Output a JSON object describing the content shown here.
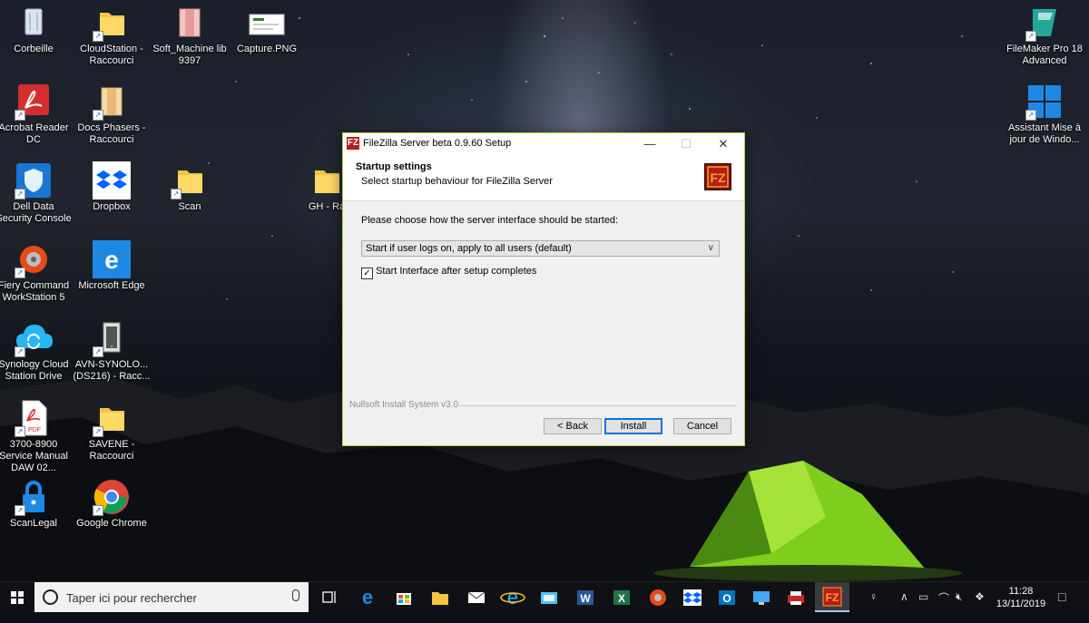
{
  "desktop": {
    "icons": [
      {
        "label": "Corbeille"
      },
      {
        "label": "CloudStation - Raccourci"
      },
      {
        "label": "Soft_Machine lib 9397"
      },
      {
        "label": "Capture.PNG"
      },
      {
        "label": "Acrobat Reader DC"
      },
      {
        "label": "Docs Phasers - Raccourci"
      },
      {
        "label": "Dell Data Security Console"
      },
      {
        "label": "Dropbox"
      },
      {
        "label": "Scan"
      },
      {
        "label": "GH - Ra"
      },
      {
        "label": "Fiery Command WorkStation 5"
      },
      {
        "label": "Microsoft Edge"
      },
      {
        "label": "Synology Cloud Station Drive"
      },
      {
        "label": "AVN-SYNOLO... (DS216) - Racc..."
      },
      {
        "label": "3700-8900 Service Manual DAW 02..."
      },
      {
        "label": "SAVENE - Raccourci"
      },
      {
        "label": "ScanLegal"
      },
      {
        "label": "Google Chrome"
      },
      {
        "label": "FileMaker Pro 18 Advanced"
      },
      {
        "label": "Assistant Mise à jour de Windo..."
      }
    ]
  },
  "dialog": {
    "title": "FileZilla Server beta 0.9.60 Setup",
    "app_icon": "FZ",
    "header_title": "Startup settings",
    "header_subtitle": "Select startup behaviour for FileZilla Server",
    "prompt": "Please choose how the server interface should be started:",
    "startup_option": "Start if user logs on, apply to all users (default)",
    "checkbox_label": "Start Interface after setup completes",
    "checkbox_checked": true,
    "footer_brand": "Nullsoft Install System v3.0",
    "back_label": "< Back",
    "install_label": "Install",
    "cancel_label": "Cancel",
    "minimize_glyph": "—",
    "maximize_glyph": "☐",
    "close_glyph": "✕"
  },
  "taskbar": {
    "search_placeholder": "Taper ici pour rechercher",
    "time": "11:28",
    "date": "13/11/2019"
  },
  "colors": {
    "dialog_border": "#b9d140",
    "accent": "#0078d7",
    "filezilla_red": "#b71c1c"
  }
}
